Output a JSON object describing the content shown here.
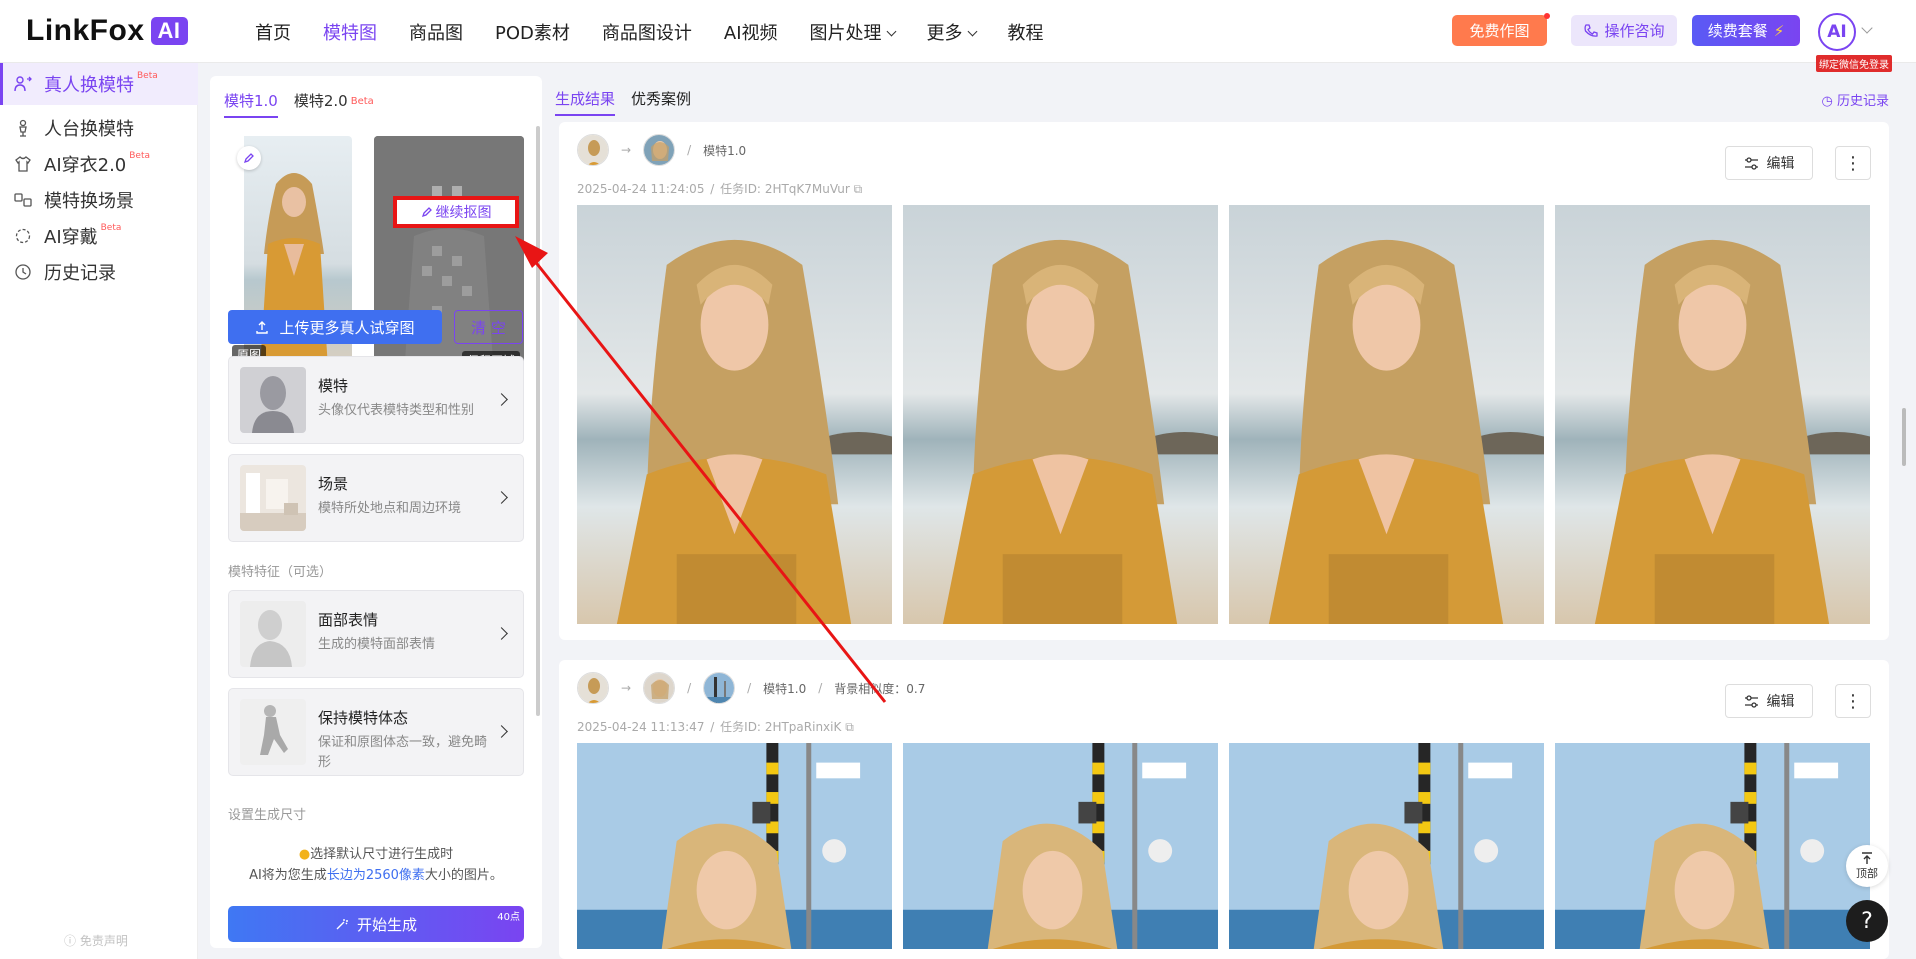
{
  "header": {
    "logo_text": "LinkFox",
    "logo_ai": "AI",
    "nav": [
      {
        "label": "首页"
      },
      {
        "label": "模特图",
        "active": true
      },
      {
        "label": "商品图"
      },
      {
        "label": "POD素材"
      },
      {
        "label": "商品图设计"
      },
      {
        "label": "AI视频"
      },
      {
        "label": "图片处理"
      },
      {
        "label": "更多"
      },
      {
        "label": "教程"
      }
    ],
    "free_btn": "免费作图",
    "consult_btn": "操作咨询",
    "renew_btn": "续费套餐",
    "avatar_text": "AI",
    "bind_badge": "绑定微信免登录"
  },
  "sidebar": {
    "items": [
      {
        "label": "真人换模特",
        "beta": "Beta",
        "active": true
      },
      {
        "label": "人台换模特"
      },
      {
        "label": "AI穿衣2.0",
        "beta": "Beta"
      },
      {
        "label": "模特换场景"
      },
      {
        "label": "AI穿戴",
        "beta": "Beta"
      },
      {
        "label": "历史记录"
      }
    ],
    "disclaimer": "免责声明"
  },
  "panel": {
    "tab1": "模特1.0",
    "tab2": "模特2.0",
    "tab2_beta": "Beta",
    "original_chip": "原图",
    "keep_chip": "保留区域",
    "continue_btn": "继续抠图",
    "upload_btn": "上传更多真人试穿图",
    "clear_btn": "清 空",
    "cards": [
      {
        "title": "模特",
        "desc": "头像仅代表模特类型和性别"
      },
      {
        "title": "场景",
        "desc": "模特所处地点和周边环境"
      },
      {
        "title": "面部表情",
        "desc": "生成的模特面部表情"
      },
      {
        "title": "保持模特体态",
        "desc": "保证和原图体态一致，避免畸形"
      }
    ],
    "feature_label": "模特特征（可选）",
    "size_label": "设置生成尺寸",
    "tip1": "选择默认尺寸进行生成时",
    "tip2_prefix": "AI将为您生成",
    "tip2_highlight": "长边为2560像素",
    "tip2_suffix": "大小的图片。",
    "gen_btn": "开始生成",
    "gen_cost": "40点"
  },
  "results": {
    "tab_results": "生成结果",
    "tab_cases": "优秀案例",
    "history_link": "历史记录",
    "cards": [
      {
        "model": "模特1.0",
        "extra": "",
        "time": "2025-04-24 11:24:05",
        "task_label": "任务ID:",
        "task_id": "2HTqK7MuVur",
        "edit": "编辑"
      },
      {
        "model": "模特1.0",
        "extra": "背景相似度：0.7",
        "time": "2025-04-24 11:13:47",
        "task_label": "任务ID:",
        "task_id": "2HTpaRinxiK",
        "edit": "编辑"
      }
    ],
    "top_btn": "顶部",
    "help_btn": "?"
  },
  "colors": {
    "accent": "#7a44f1",
    "blue": "#3f6ff0",
    "annotation": "#e81515"
  }
}
